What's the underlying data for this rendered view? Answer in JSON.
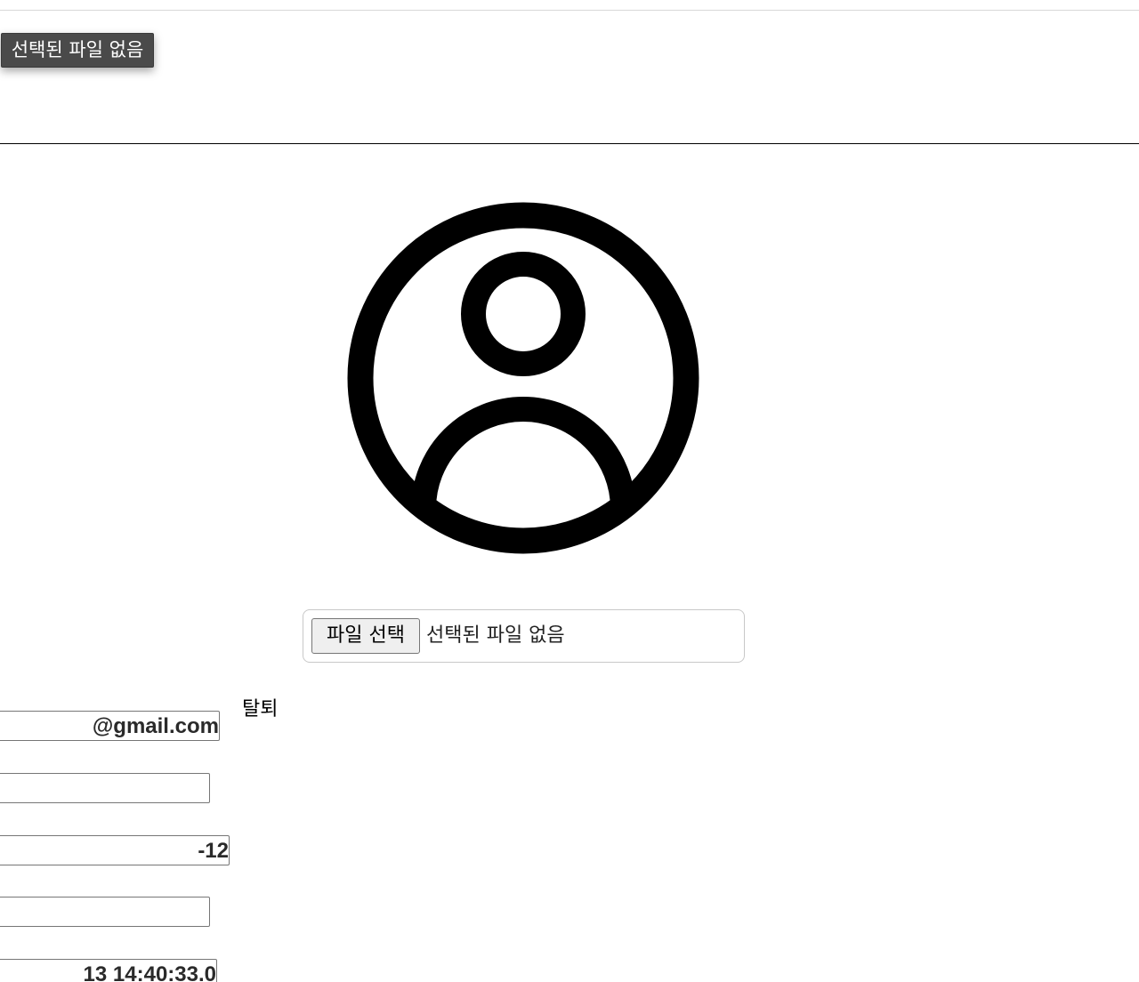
{
  "tooltip": {
    "text": "선택된 파일 없음"
  },
  "profile": {
    "avatar_icon": "user-circle-icon",
    "file_input": {
      "button_label": "파일 선택",
      "status": "선택된 파일 없음"
    },
    "withdraw_label": "탈퇴"
  },
  "fields": {
    "email": "@gmail.com",
    "field2": "",
    "date": "-12",
    "field4": "",
    "timestamp": "13 14:40:33.0"
  }
}
